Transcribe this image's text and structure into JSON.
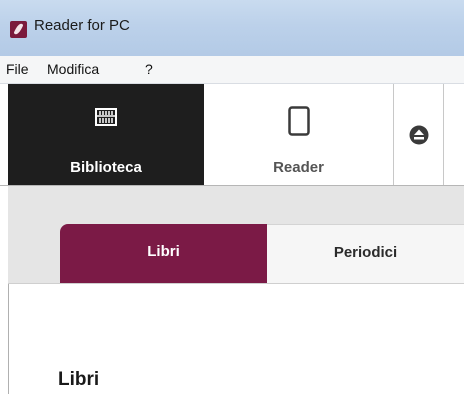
{
  "window": {
    "title": "Reader for PC"
  },
  "menubar": {
    "items": [
      {
        "label": "File"
      },
      {
        "label": "Modifica"
      },
      {
        "label": "?"
      }
    ]
  },
  "toolbar": {
    "library": {
      "label": "Biblioteca",
      "icon": "bookshelf-icon",
      "active": true
    },
    "reader": {
      "label": "Reader",
      "icon": "ereader-device-icon",
      "active": false
    },
    "eject": {
      "icon": "eject-icon"
    }
  },
  "tabs": [
    {
      "label": "Libri",
      "selected": true
    },
    {
      "label": "Periodici",
      "selected": false
    }
  ],
  "content": {
    "heading": "Libri"
  },
  "colors": {
    "accent": "#7b1a46",
    "toolbar_active": "#1e1e1e",
    "titlebar": "#bcd1ea"
  }
}
